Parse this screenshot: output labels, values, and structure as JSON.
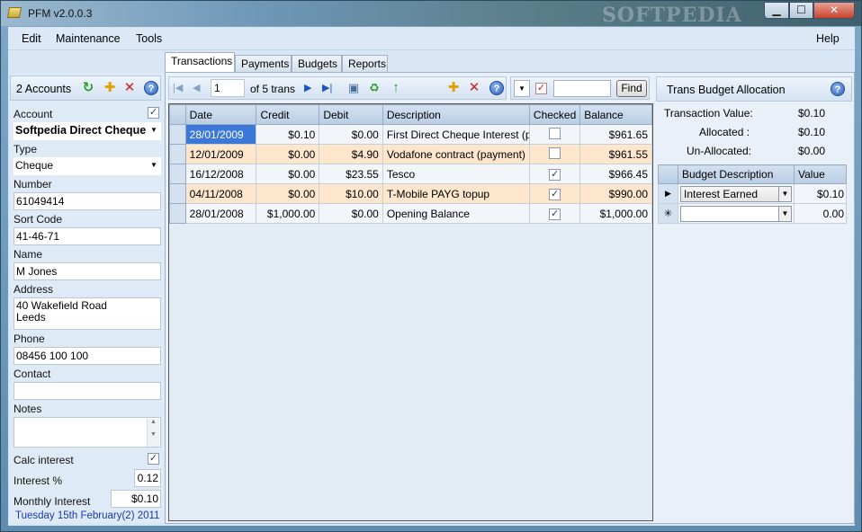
{
  "window": {
    "title": "PFM v2.0.0.3",
    "watermark": "SOFTPEDIA",
    "min_glyph": "▁",
    "max_glyph": "☐",
    "close_glyph": "✕"
  },
  "menu": {
    "edit": "Edit",
    "maintenance": "Maintenance",
    "tools": "Tools",
    "help": "Help"
  },
  "accounts": {
    "header": "2 Accounts",
    "labels": {
      "account": "Account",
      "type": "Type",
      "number": "Number",
      "sort_code": "Sort Code",
      "name": "Name",
      "address": "Address",
      "phone": "Phone",
      "contact": "Contact",
      "notes": "Notes",
      "calc_interest": "Calc interest",
      "interest_pct": "Interest %",
      "monthly_interest": "Monthly Interest"
    },
    "values": {
      "account": "Softpedia Direct Cheque",
      "type": "Cheque",
      "number": "61049414",
      "sort_code": "41-46-71",
      "name": "M Jones",
      "address_line1": "40 Wakefield Road",
      "address_line2": "Leeds",
      "phone": "08456 100 100",
      "contact": "",
      "notes": "",
      "interest_pct": "0.12",
      "monthly_interest": "$0.10"
    },
    "calc_interest_checked": true,
    "date_footer": "Tuesday 15th February(2) 2011"
  },
  "tabs": [
    "Transactions",
    "Payments",
    "Budgets",
    "Reports"
  ],
  "nav": {
    "position": "1",
    "of_text": "of 5 trans",
    "find_label": "Find"
  },
  "grid": {
    "columns": [
      "Date",
      "Credit",
      "Debit",
      "Description",
      "Checked",
      "Balance"
    ],
    "rows": [
      {
        "date": "28/01/2009",
        "credit": "$0.10",
        "debit": "$0.00",
        "description": "First Direct Cheque Interest (pa...",
        "checked": false,
        "balance": "$961.65"
      },
      {
        "date": "12/01/2009",
        "credit": "$0.00",
        "debit": "$4.90",
        "description": "Vodafone contract (payment)",
        "checked": false,
        "balance": "$961.55"
      },
      {
        "date": "16/12/2008",
        "credit": "$0.00",
        "debit": "$23.55",
        "description": "Tesco",
        "checked": true,
        "balance": "$966.45"
      },
      {
        "date": "04/11/2008",
        "credit": "$0.00",
        "debit": "$10.00",
        "description": "T-Mobile PAYG topup",
        "checked": true,
        "balance": "$990.00"
      },
      {
        "date": "28/01/2008",
        "credit": "$1,000.00",
        "debit": "$0.00",
        "description": "Opening Balance",
        "checked": true,
        "balance": "$1,000.00"
      }
    ]
  },
  "allocation": {
    "header": "Trans Budget Allocation",
    "transaction_value_label": "Transaction Value:",
    "transaction_value": "$0.10",
    "allocated_label": "Allocated :",
    "allocated": "$0.10",
    "unallocated_label": "Un-Allocated:",
    "unallocated": "$0.00",
    "columns": [
      "Budget Description",
      "Value"
    ],
    "rows": [
      {
        "marker": "▶",
        "description": "Interest Earned",
        "value": "$0.10"
      },
      {
        "marker": "✳",
        "description": "",
        "value": "0.00"
      }
    ]
  },
  "colors": {
    "row_alt": "#fde6cc",
    "selection": "#3b78d8",
    "date_footer": "#1a36b0"
  }
}
